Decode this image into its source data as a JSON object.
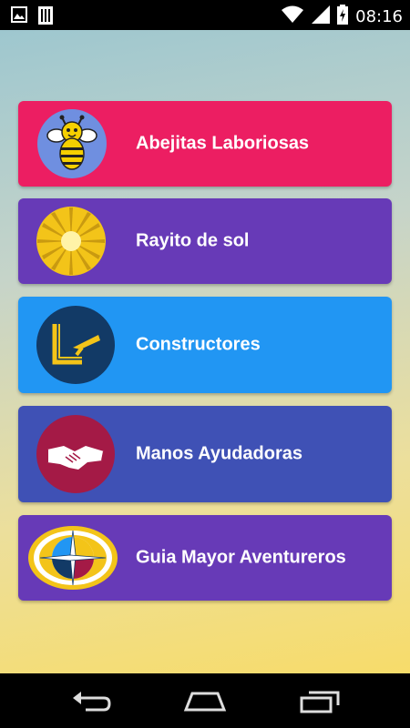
{
  "status_bar": {
    "time": "08:16",
    "left_icons": [
      "image-notification-icon",
      "sim-card-icon"
    ],
    "right_icons": [
      "wifi-icon",
      "signal-icon",
      "battery-icon"
    ]
  },
  "menu": {
    "items": [
      {
        "label": "Abejitas Laboriosas",
        "color": "#ec1e62",
        "icon": "bee-icon"
      },
      {
        "label": "Rayito de sol",
        "color": "#673ab7",
        "icon": "sun-icon"
      },
      {
        "label": "Constructores",
        "color": "#2196f3",
        "icon": "trowel-icon"
      },
      {
        "label": "Manos Ayudadoras",
        "color": "#3f51b5",
        "icon": "handshake-icon"
      },
      {
        "label": "Guia Mayor Aventureros",
        "color": "#673ab7",
        "icon": "adventurers-emblem-icon"
      }
    ]
  },
  "nav_bar": {
    "buttons": [
      "back-icon",
      "home-icon",
      "recent-apps-icon"
    ]
  }
}
